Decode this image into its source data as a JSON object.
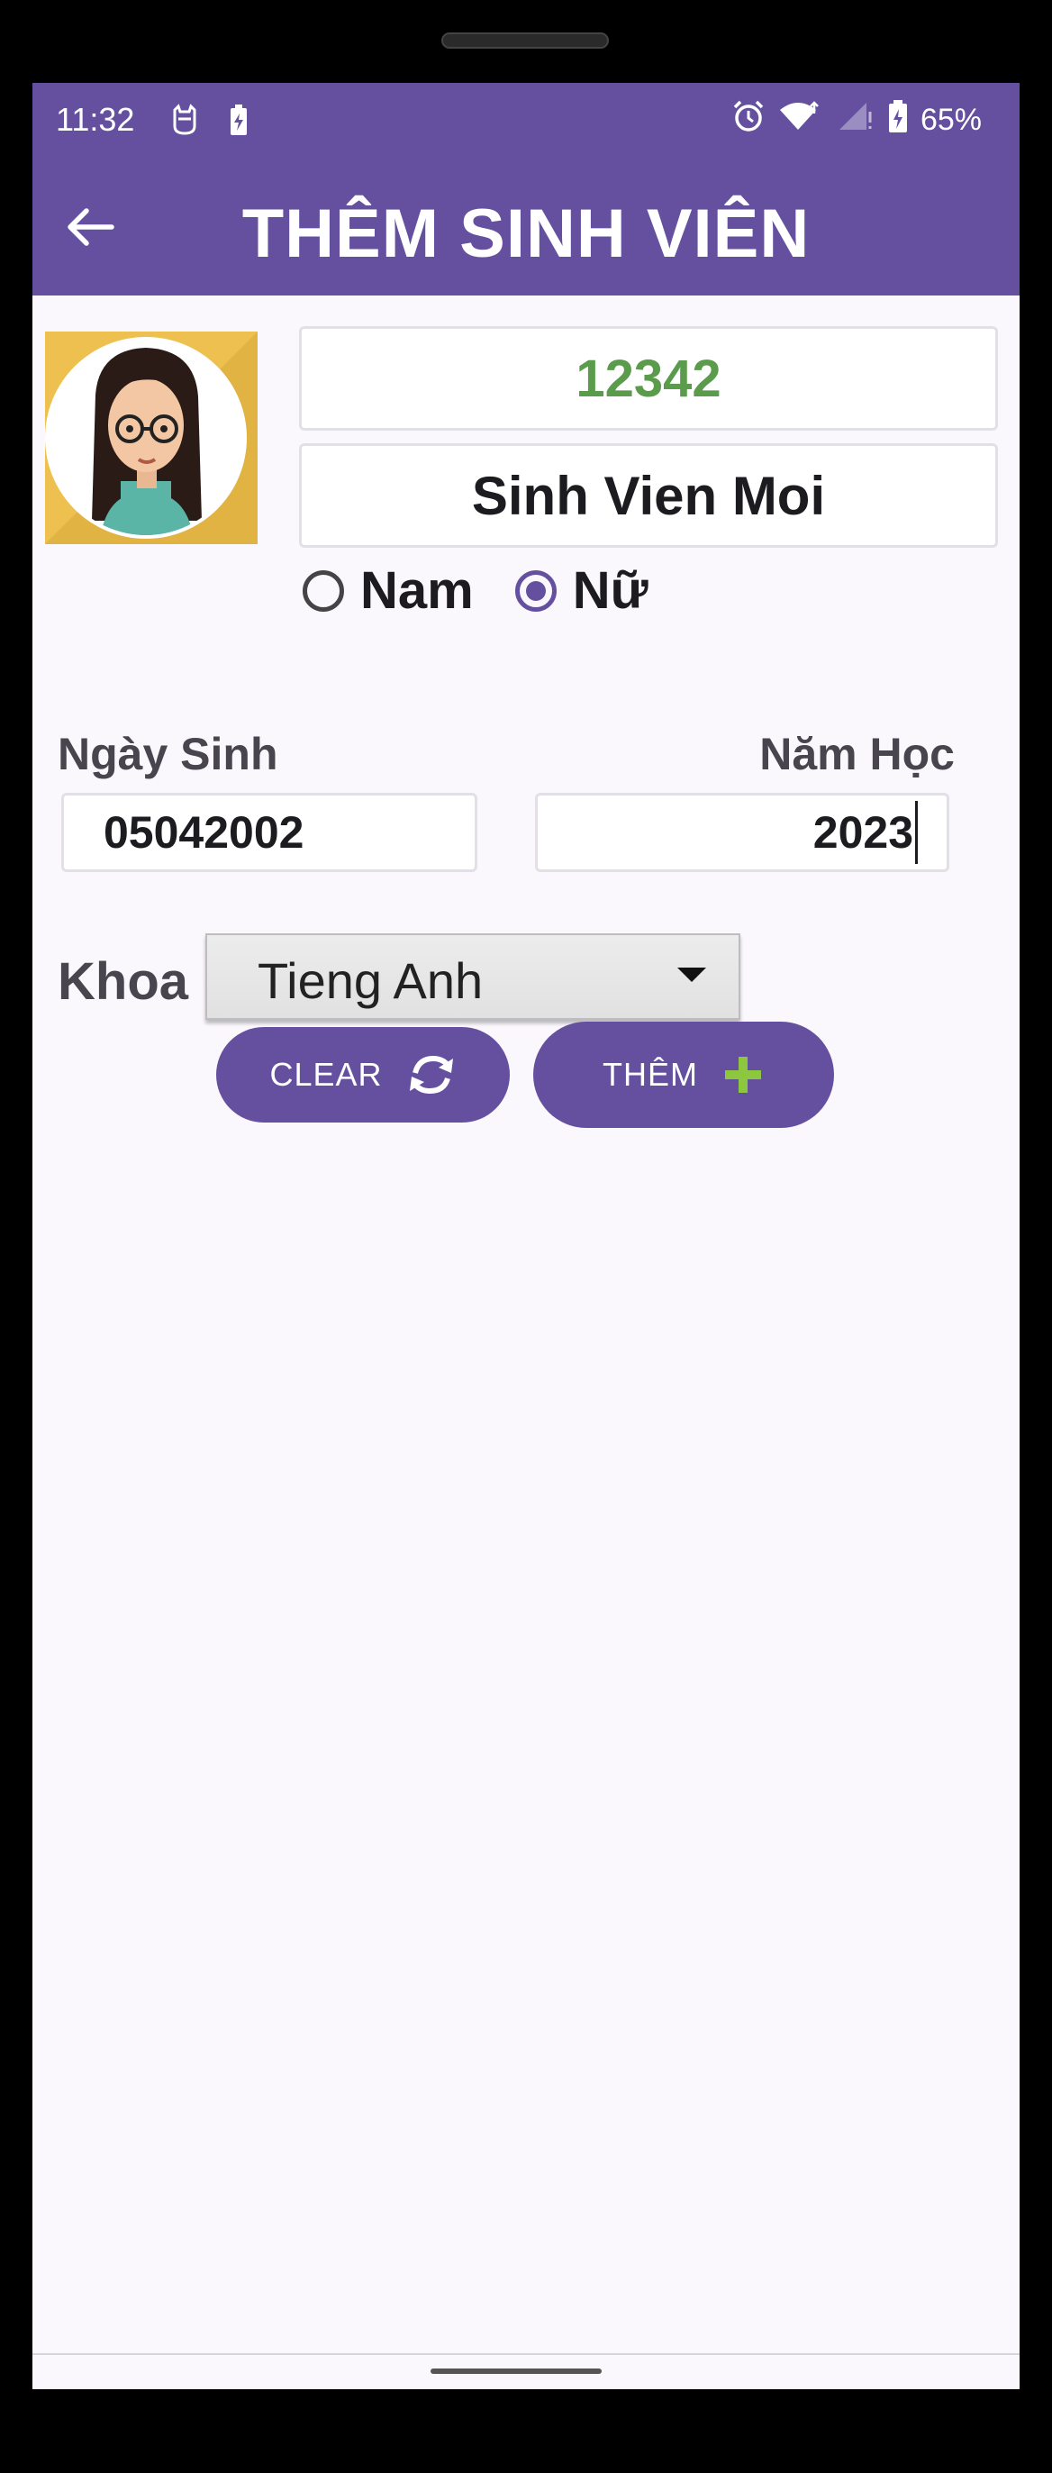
{
  "status_bar": {
    "time": "11:32",
    "battery_percent": "65%",
    "icons": [
      "cat-notification-icon",
      "battery-saver-icon",
      "alarm-icon",
      "wifi-icon",
      "signal-icon",
      "battery-icon"
    ]
  },
  "app_bar": {
    "title": "THÊM SINH VIÊN",
    "back_icon": "arrow-left-icon"
  },
  "form": {
    "avatar_icon": "female-student-avatar",
    "student_id": "12342",
    "student_name": "Sinh Vien Moi",
    "gender_options": [
      {
        "label": "Nam",
        "checked": false
      },
      {
        "label": "Nữ",
        "checked": true
      }
    ],
    "dob_label": "Ngày Sinh",
    "dob_value": "05042002",
    "year_label": "Năm Học",
    "year_value": "2023",
    "faculty_label": "Khoa",
    "faculty_selected": "Tieng Anh"
  },
  "actions": {
    "clear_label": "CLEAR",
    "clear_icon": "refresh-icon",
    "add_label": "THÊM",
    "add_icon": "plus-icon"
  },
  "colors": {
    "primary": "#6550a0",
    "id_text": "#5a9c4c",
    "plus_icon": "#8dc63f",
    "avatar_bg": "#edc04f"
  }
}
